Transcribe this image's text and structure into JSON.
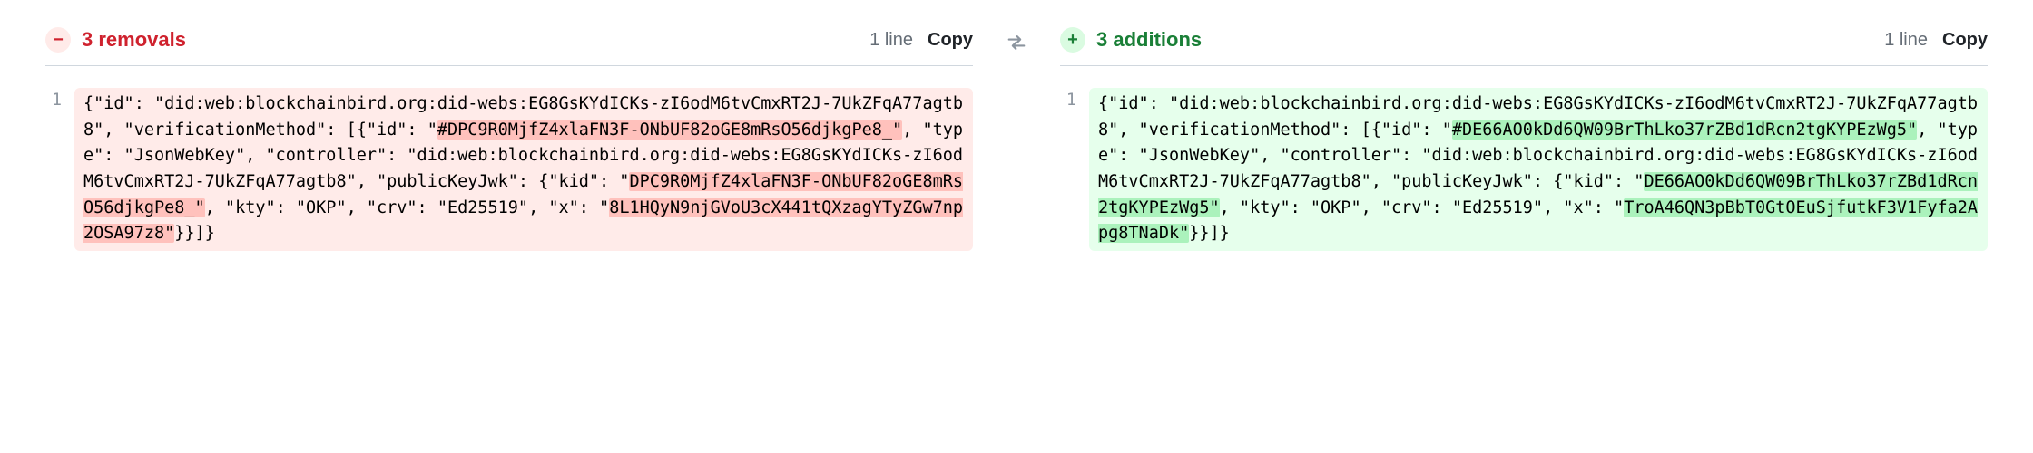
{
  "left": {
    "badge_glyph": "−",
    "summary": "3 removals",
    "lines": "1 line",
    "copy": "Copy",
    "line_num": "1",
    "segments": [
      {
        "t": "{\"id\": \"did:web:blockchainbird.org:did-webs:EG8GsKYdICKs-zI6odM6tvCmxRT2J-7UkZFqA77agtb8\", \"verificationMethod\": [{\"id\": \"",
        "hl": false
      },
      {
        "t": "#DPC9R0MjfZ4xlaFN3F-ONbUF82oGE8mRsO56djkgPe8_\"",
        "hl": true
      },
      {
        "t": ", \"type\": \"JsonWebKey\", \"controller\": \"did:web:blockchainbird.org:did-webs:EG8GsKYdICKs-zI6odM6tvCmxRT2J-7UkZFqA77agtb8\", \"publicKeyJwk\": {\"kid\": \"",
        "hl": false
      },
      {
        "t": "DPC9R0MjfZ4xlaFN3F-ONbUF82oGE8mRsO56djkgPe8_\"",
        "hl": true
      },
      {
        "t": ", \"kty\": \"OKP\", \"crv\": \"Ed25519\", \"x\": \"",
        "hl": false
      },
      {
        "t": "8L1HQyN9njGVoU3cX441tQXzagYTyZGw7np2OSA97z8\"",
        "hl": true
      },
      {
        "t": "}}]}",
        "hl": false
      }
    ]
  },
  "right": {
    "badge_glyph": "+",
    "summary": "3 additions",
    "lines": "1 line",
    "copy": "Copy",
    "line_num": "1",
    "segments": [
      {
        "t": "{\"id\": \"did:web:blockchainbird.org:did-webs:EG8GsKYdICKs-zI6odM6tvCmxRT2J-7UkZFqA77agtb8\", \"verificationMethod\": [{\"id\": \"",
        "hl": false
      },
      {
        "t": "#DE66AO0kDd6QW09BrThLko37rZBd1dRcn2tgKYPEzWg5\"",
        "hl": true
      },
      {
        "t": ", \"type\": \"JsonWebKey\", \"controller\": \"did:web:blockchainbird.org:did-webs:EG8GsKYdICKs-zI6odM6tvCmxRT2J-7UkZFqA77agtb8\", \"publicKeyJwk\": {\"kid\": \"",
        "hl": false
      },
      {
        "t": "DE66AO0kDd6QW09BrThLko37rZBd1dRcn2tgKYPEzWg5\"",
        "hl": true
      },
      {
        "t": ", \"kty\": \"OKP\", \"crv\": \"Ed25519\", \"x\": \"",
        "hl": false
      },
      {
        "t": "TroA46QN3pBbT0GtOEuSjfutkF3V1Fyfa2Apg8TNaDk\"",
        "hl": true
      },
      {
        "t": "}}]}",
        "hl": false
      }
    ]
  }
}
